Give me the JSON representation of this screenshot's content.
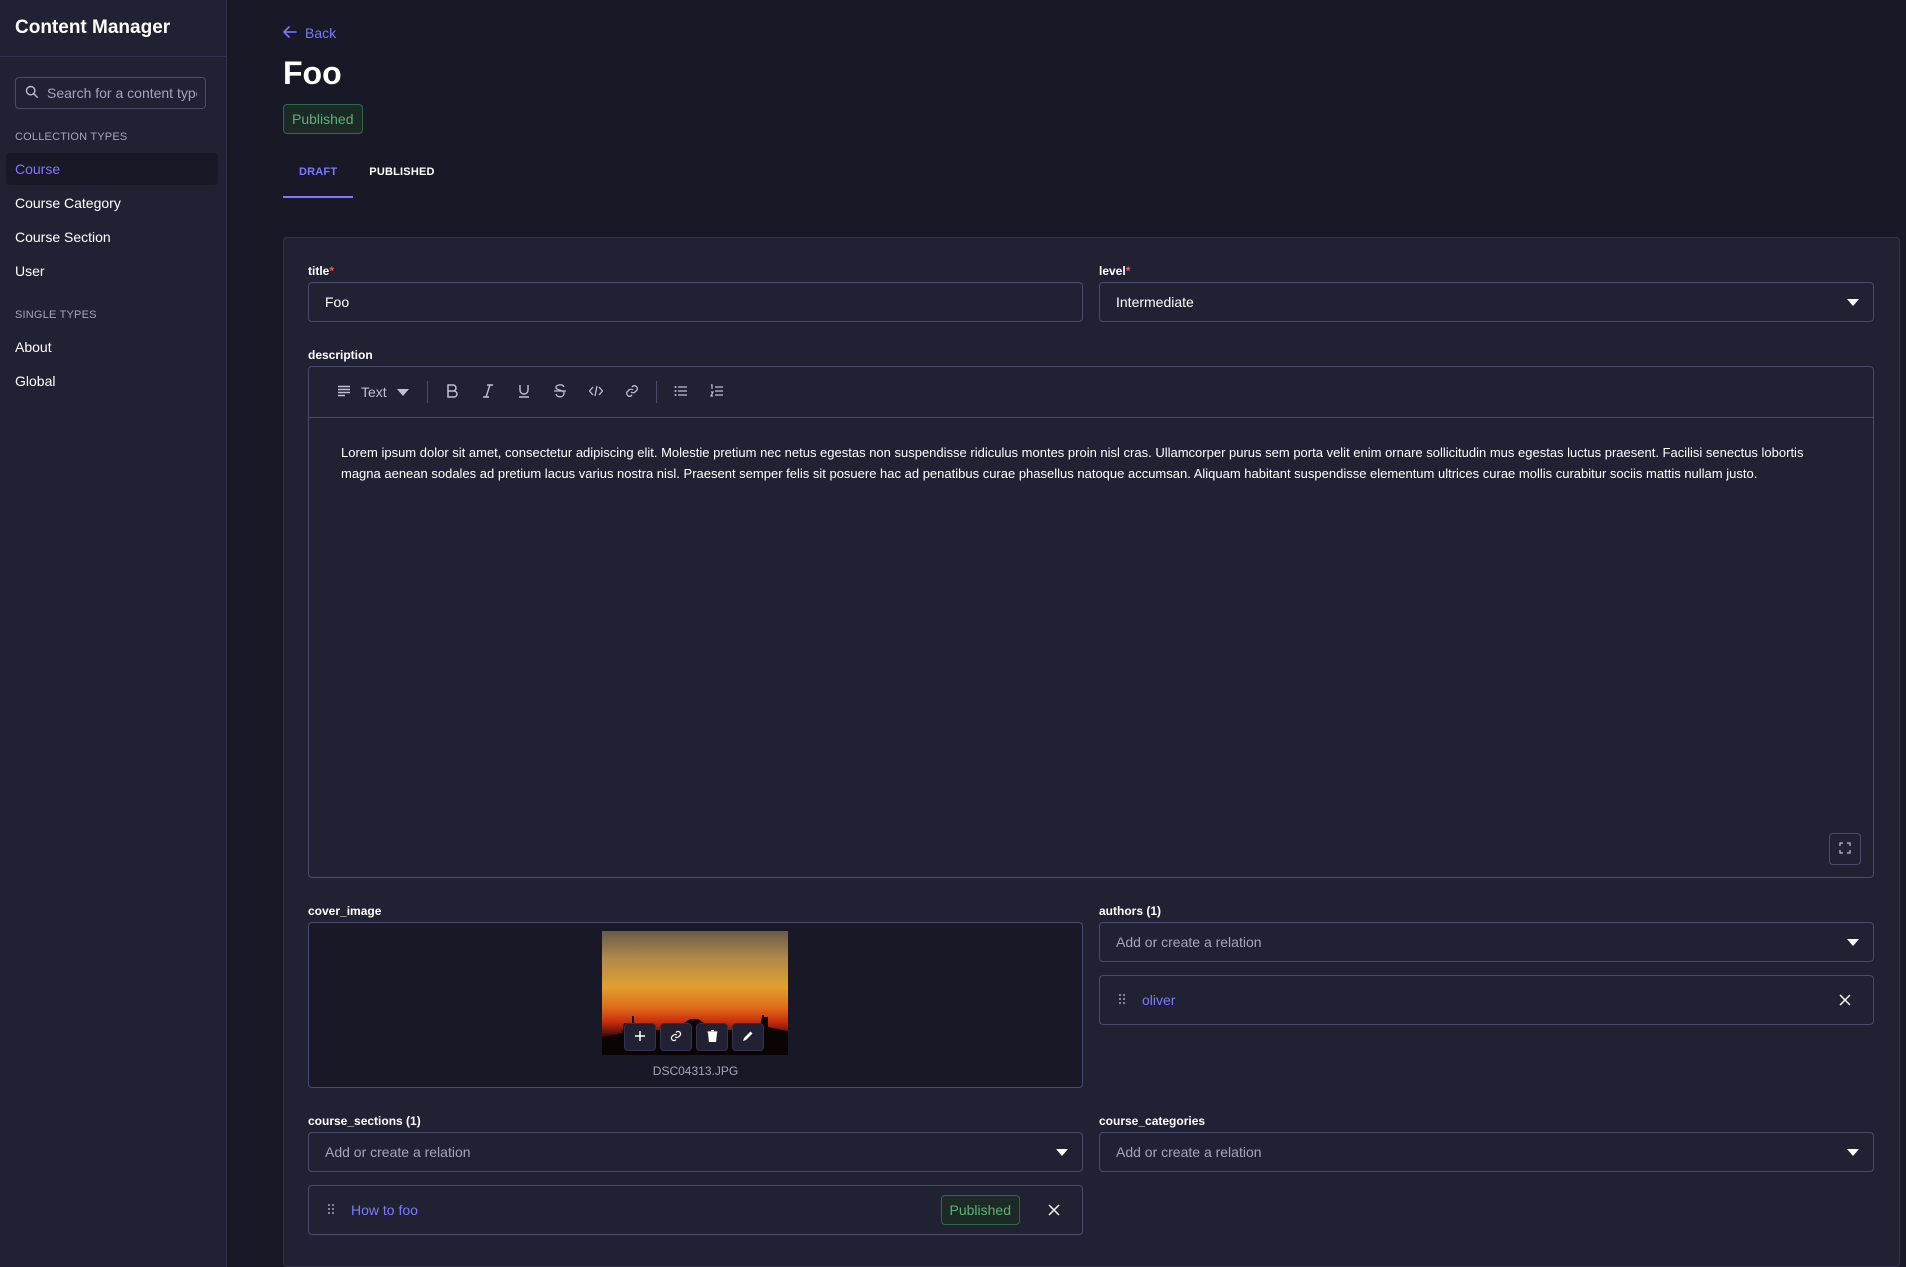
{
  "sidebar": {
    "title": "Content Manager",
    "search_placeholder": "Search for a content type",
    "collection_label": "COLLECTION TYPES",
    "collection_items": [
      "Course",
      "Course Category",
      "Course Section",
      "User"
    ],
    "single_label": "SINGLE TYPES",
    "single_items": [
      "About",
      "Global"
    ]
  },
  "header": {
    "back_label": "Back",
    "title": "Foo",
    "status": "Published"
  },
  "tabs": [
    "DRAFT",
    "PUBLISHED"
  ],
  "form": {
    "title": {
      "label": "title",
      "required_mark": "*",
      "value": "Foo"
    },
    "level": {
      "label": "level",
      "required_mark": "*",
      "value": "Intermediate"
    },
    "description": {
      "label": "description",
      "block_type": "Text",
      "text": "Lorem ipsum dolor sit amet, consectetur adipiscing elit. Molestie pretium nec netus egestas non suspendisse ridiculus montes proin nisl cras. Ullamcorper purus sem porta velit enim ornare sollicitudin mus egestas luctus praesent. Facilisi senectus lobortis magna aenean sodales ad pretium lacus varius nostra nisl. Praesent semper felis sit posuere hac ad penatibus curae phasellus natoque accumsan. Aliquam habitant suspendisse elementum ultrices curae mollis curabitur sociis mattis nullam justo."
    },
    "cover_image": {
      "label": "cover_image",
      "file_name": "DSC04313.JPG"
    },
    "authors": {
      "label": "authors (1)",
      "placeholder": "Add or create a relation",
      "items": [
        "oliver"
      ]
    },
    "course_sections": {
      "label": "course_sections (1)",
      "placeholder": "Add or create a relation",
      "items": [
        {
          "name": "How to foo",
          "status": "Published"
        }
      ]
    },
    "course_categories": {
      "label": "course_categories",
      "placeholder": "Add or create a relation"
    }
  },
  "colors": {
    "accent": "#7b79ff",
    "background": "#181826",
    "surface": "#212134",
    "success": "#5cb176"
  },
  "icons": [
    "search-icon",
    "arrow-left-icon",
    "paragraph-icon",
    "bold-icon",
    "italic-icon",
    "underline-icon",
    "strikethrough-icon",
    "code-icon",
    "link-icon",
    "bullet-list-icon",
    "numbered-list-icon",
    "expand-icon",
    "plus-icon",
    "trash-icon",
    "pencil-icon",
    "drag-handle-icon",
    "close-icon",
    "chevron-down-icon"
  ]
}
